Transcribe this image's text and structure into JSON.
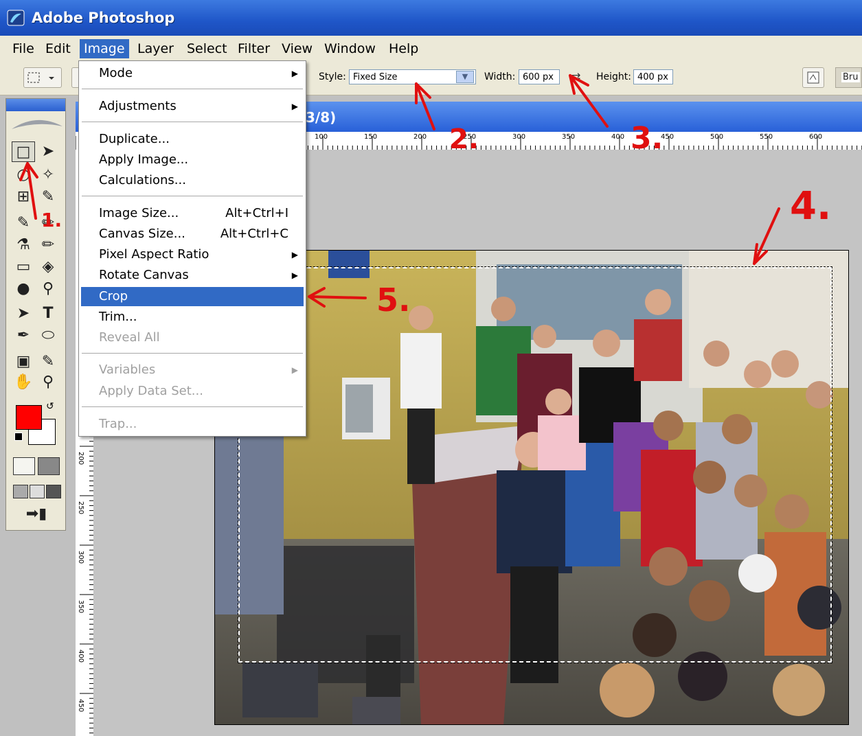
{
  "app": {
    "title": "Adobe Photoshop"
  },
  "menubar": {
    "items": [
      "File",
      "Edit",
      "Image",
      "Layer",
      "Select",
      "Filter",
      "View",
      "Window",
      "Help"
    ],
    "active": "Image"
  },
  "options": {
    "style_label": "Style:",
    "style_value": "Fixed Size",
    "width_label": "Width:",
    "width_value": "600 px",
    "height_label": "Height:",
    "height_value": "400 px",
    "brushes_label": "Bru"
  },
  "document": {
    "title_fragment": "3/8)"
  },
  "ruler": {
    "h_ticks": [
      "100",
      "150",
      "200",
      "250",
      "300",
      "350",
      "400",
      "450",
      "500",
      "550",
      "600"
    ],
    "v_ticks": [
      "200",
      "250",
      "300",
      "350",
      "400",
      "450"
    ]
  },
  "image_menu": {
    "mode": "Mode",
    "adjustments": "Adjustments",
    "duplicate": "Duplicate...",
    "apply_image": "Apply Image...",
    "calculations": "Calculations...",
    "image_size": "Image Size...",
    "image_size_sc": "Alt+Ctrl+I",
    "canvas_size": "Canvas Size...",
    "canvas_size_sc": "Alt+Ctrl+C",
    "pixel_aspect": "Pixel Aspect Ratio",
    "rotate_canvas": "Rotate Canvas",
    "crop": "Crop",
    "trim": "Trim...",
    "reveal_all": "Reveal All",
    "variables": "Variables",
    "apply_data_set": "Apply Data Set...",
    "trap": "Trap..."
  },
  "annotations": {
    "a1": "1.",
    "a2": "2.",
    "a3": "3.",
    "a4": "4.",
    "a5": "5."
  },
  "colors": {
    "foreground": "#ff0000",
    "background": "#ffffff",
    "accent": "#316ac5",
    "annotation": "#e01010"
  }
}
